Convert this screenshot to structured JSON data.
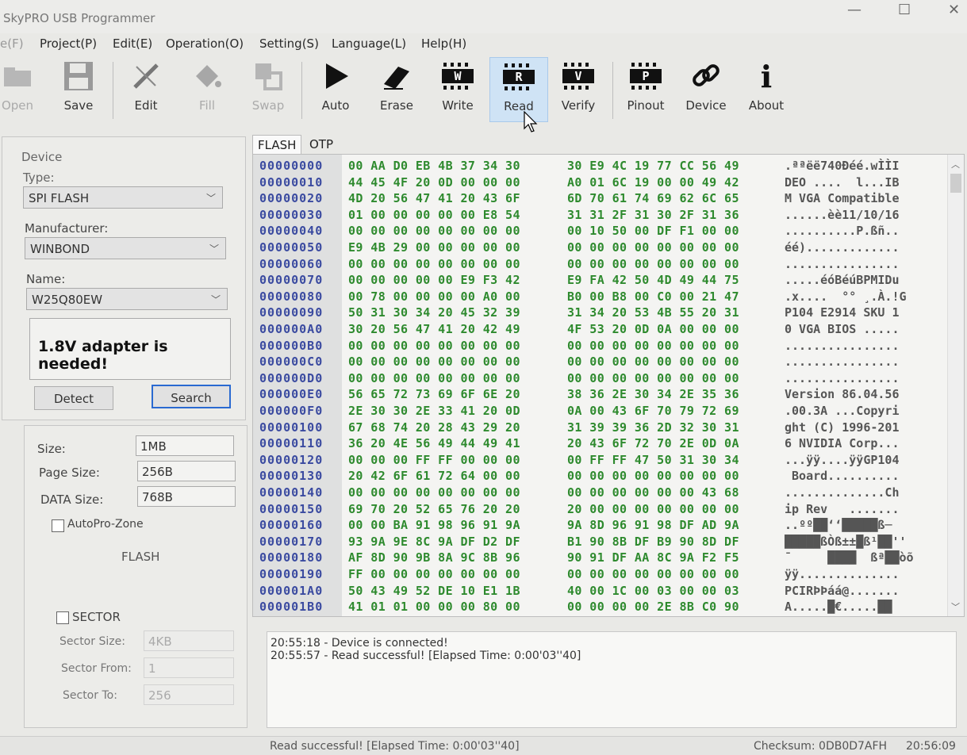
{
  "window": {
    "title": "SkyPRO USB Programmer",
    "minimize": "—",
    "maximize": "☐",
    "close": "✕"
  },
  "menu": [
    "e(F)",
    "Project(P)",
    "Edit(E)",
    "Operation(O)",
    "Setting(S)",
    "Language(L)",
    "Help(H)"
  ],
  "toolbar": {
    "open": "Open",
    "save": "Save",
    "edit": "Edit",
    "fill": "Fill",
    "swap": "Swap",
    "auto": "Auto",
    "erase": "Erase",
    "write": "Write",
    "read": "Read",
    "verify": "Verify",
    "pinout": "Pinout",
    "device": "Device",
    "about": "About",
    "write_chip": "W",
    "read_chip": "R",
    "verify_chip": "V",
    "pinout_chip": "P",
    "about_glyph": "i"
  },
  "device": {
    "group_label": "Device",
    "type_label": "Type:",
    "type_value": "SPI FLASH",
    "manufacturer_label": "Manufacturer:",
    "manufacturer_value": "WINBOND",
    "name_label": "Name:",
    "name_value": "W25Q80EW",
    "message": "1.8V adapter is needed!",
    "detect": "Detect",
    "search": "Search"
  },
  "info": {
    "size_label": "Size:",
    "size_value": "1MB",
    "page_label": "Page Size:",
    "page_value": "256B",
    "data_label": "DATA Size:",
    "data_value": "768B",
    "autopro_label": "AutoPro-Zone",
    "flash_label": "FLASH",
    "sector_label": "SECTOR",
    "sector_size_label": "Sector Size:",
    "sector_size_value": "4KB",
    "sector_from_label": "Sector From:",
    "sector_from_value": "1",
    "sector_to_label": "Sector To:",
    "sector_to_value": "256"
  },
  "tabs": [
    "FLASH",
    "OTP"
  ],
  "hex_rows": [
    {
      "addr": "00000000",
      "h1": "00 AA D0 EB 4B 37 34 30",
      "h2": "30 E9 4C 19 77 CC 56 49",
      "asc": ".ªªëë740Ðéé.wÌÌI"
    },
    {
      "addr": "00000010",
      "h1": "44 45 4F 20 0D 00 00 00",
      "h2": "A0 01 6C 19 00 00 49 42",
      "asc": "DEO ....  l...IB"
    },
    {
      "addr": "00000020",
      "h1": "4D 20 56 47 41 20 43 6F",
      "h2": "6D 70 61 74 69 62 6C 65",
      "asc": "M VGA Compatible"
    },
    {
      "addr": "00000030",
      "h1": "01 00 00 00 00 00 E8 54",
      "h2": "31 31 2F 31 30 2F 31 36",
      "asc": "......èè11/10/16"
    },
    {
      "addr": "00000040",
      "h1": "00 00 00 00 00 00 00 00",
      "h2": "00 10 50 00 DF F1 00 00",
      "asc": "..........P.ßñ.."
    },
    {
      "addr": "00000050",
      "h1": "E9 4B 29 00 00 00 00 00",
      "h2": "00 00 00 00 00 00 00 00",
      "asc": "éé)............."
    },
    {
      "addr": "00000060",
      "h1": "00 00 00 00 00 00 00 00",
      "h2": "00 00 00 00 00 00 00 00",
      "asc": "................"
    },
    {
      "addr": "00000070",
      "h1": "00 00 00 00 00 E9 F3 42",
      "h2": "E9 FA 42 50 4D 49 44 75",
      "asc": ".....éóBéúBPMIDu"
    },
    {
      "addr": "00000080",
      "h1": "00 78 00 00 00 00 A0 00",
      "h2": "B0 00 B8 00 C0 00 21 47",
      "asc": ".x....  °° ¸.À.!G"
    },
    {
      "addr": "00000090",
      "h1": "50 31 30 34 20 45 32 39",
      "h2": "31 34 20 53 4B 55 20 31",
      "asc": "P104 E2914 SKU 1"
    },
    {
      "addr": "000000A0",
      "h1": "30 20 56 47 41 20 42 49",
      "h2": "4F 53 20 0D 0A 00 00 00",
      "asc": "0 VGA BIOS ....."
    },
    {
      "addr": "000000B0",
      "h1": "00 00 00 00 00 00 00 00",
      "h2": "00 00 00 00 00 00 00 00",
      "asc": "................"
    },
    {
      "addr": "000000C0",
      "h1": "00 00 00 00 00 00 00 00",
      "h2": "00 00 00 00 00 00 00 00",
      "asc": "................"
    },
    {
      "addr": "000000D0",
      "h1": "00 00 00 00 00 00 00 00",
      "h2": "00 00 00 00 00 00 00 00",
      "asc": "................"
    },
    {
      "addr": "000000E0",
      "h1": "56 65 72 73 69 6F 6E 20",
      "h2": "38 36 2E 30 34 2E 35 36",
      "asc": "Version 86.04.56"
    },
    {
      "addr": "000000F0",
      "h1": "2E 30 30 2E 33 41 20 0D",
      "h2": "0A 00 43 6F 70 79 72 69",
      "asc": ".00.3A ...Copyri"
    },
    {
      "addr": "00000100",
      "h1": "67 68 74 20 28 43 29 20",
      "h2": "31 39 39 36 2D 32 30 31",
      "asc": "ght (C) 1996-201"
    },
    {
      "addr": "00000110",
      "h1": "36 20 4E 56 49 44 49 41",
      "h2": "20 43 6F 72 70 2E 0D 0A",
      "asc": "6 NVIDIA Corp..."
    },
    {
      "addr": "00000120",
      "h1": "00 00 00 FF FF 00 00 00",
      "h2": "00 FF FF 47 50 31 30 34",
      "asc": "...ÿÿ....ÿÿGP104"
    },
    {
      "addr": "00000130",
      "h1": "20 42 6F 61 72 64 00 00",
      "h2": "00 00 00 00 00 00 00 00",
      "asc": " Board.........."
    },
    {
      "addr": "00000140",
      "h1": "00 00 00 00 00 00 00 00",
      "h2": "00 00 00 00 00 00 43 68",
      "asc": "..............Ch"
    },
    {
      "addr": "00000150",
      "h1": "69 70 20 52 65 76 20 20",
      "h2": "20 00 00 00 00 00 00 00",
      "asc": "ip Rev   ......."
    },
    {
      "addr": "00000160",
      "h1": "00 00 BA 91 98 96 91 9A",
      "h2": "9A 8D 96 91 98 DF AD 9A",
      "asc": "..ºº██‘‘█████ß­─"
    },
    {
      "addr": "00000170",
      "h1": "93 9A 9E 8C 9A DF D2 DF",
      "h2": "B1 90 8B DF B9 90 8D DF",
      "asc": "█████ßÒß±±█ß¹██''"
    },
    {
      "addr": "00000180",
      "h1": "AF 8D 90 9B 8A 9C 8B 96",
      "h2": "90 91 DF AA 8C 9A F2 F5",
      "asc": "¯     ████  ßª██òõ"
    },
    {
      "addr": "00000190",
      "h1": "FF 00 00 00 00 00 00 00",
      "h2": "00 00 00 00 00 00 00 00",
      "asc": "ÿÿ.............."
    },
    {
      "addr": "000001A0",
      "h1": "50 43 49 52 DE 10 E1 1B",
      "h2": "40 00 1C 00 03 00 00 03",
      "asc": "PCIRÞÞáá@......."
    },
    {
      "addr": "000001B0",
      "h1": "41 01 01 00 00 00 80 00",
      "h2": "00 00 00 00 2E 8B C0 90",
      "asc": "A.....█€.....██"
    }
  ],
  "log": [
    "20:55:18  -  Device is connected!",
    "20:55:57  -  Read successful! [Elapsed Time: 0:00'03''40]"
  ],
  "status": {
    "left": "Read successful! [Elapsed Time: 0:00'03''40]",
    "checksum": "Checksum: 0DB0D7AFH",
    "time": "20:56:09"
  }
}
